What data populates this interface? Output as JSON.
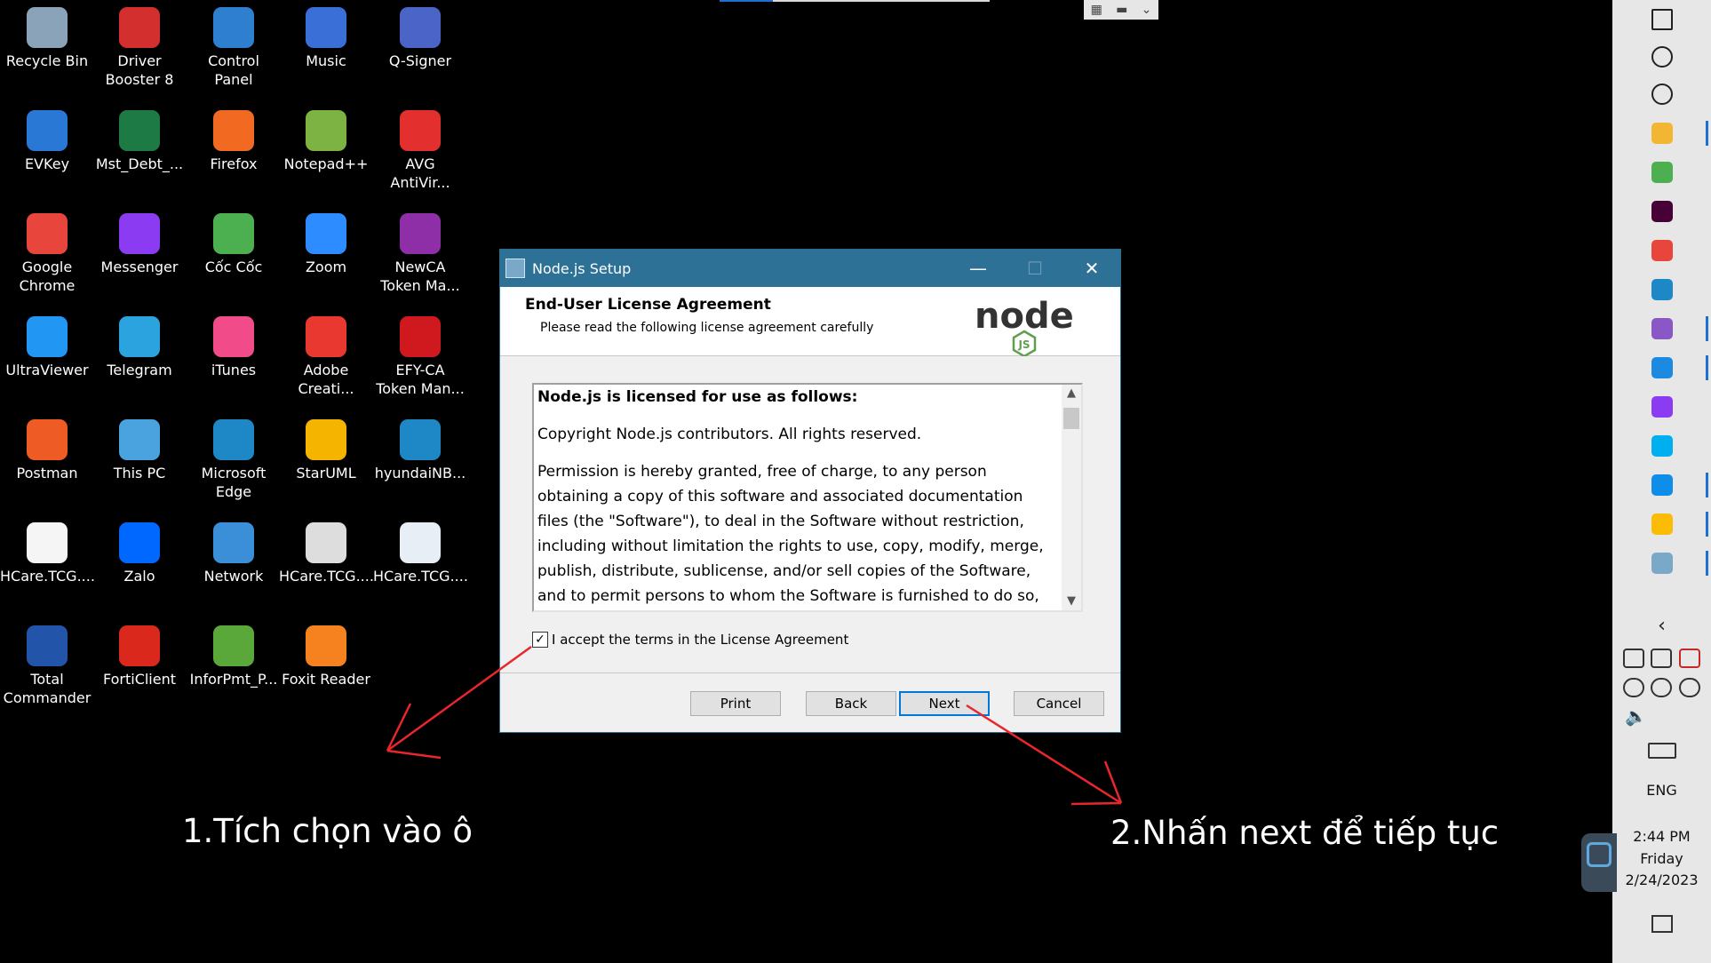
{
  "desktop_icons": [
    {
      "label": "Recycle Bin",
      "icon": "recycle-bin-icon",
      "color": "#8aa3b8"
    },
    {
      "label": "Driver\nBooster 8",
      "icon": "driver-booster-icon",
      "color": "#d32f2f"
    },
    {
      "label": "Control\nPanel",
      "icon": "control-panel-icon",
      "color": "#2f7fd1"
    },
    {
      "label": "Music",
      "icon": "music-folder-icon",
      "color": "#3b6fd8"
    },
    {
      "label": "Q-Signer",
      "icon": "q-signer-icon",
      "color": "#4a64c8"
    },
    {
      "label": "EVKey",
      "icon": "evkey-icon",
      "color": "#2a78d6"
    },
    {
      "label": "Mst_Debt_...",
      "icon": "excel-icon",
      "color": "#1d7a44"
    },
    {
      "label": "Firefox",
      "icon": "firefox-icon",
      "color": "#f26a21"
    },
    {
      "label": "Notepad++",
      "icon": "notepad-plus-plus-icon",
      "color": "#7cb342"
    },
    {
      "label": "AVG\nAntiVir...",
      "icon": "avg-antivirus-icon",
      "color": "#e3302f"
    },
    {
      "label": "Google\nChrome",
      "icon": "chrome-icon",
      "color": "#e8453c"
    },
    {
      "label": "Messenger",
      "icon": "messenger-icon",
      "color": "#8b3cf3"
    },
    {
      "label": "Cốc Cốc",
      "icon": "coccoc-icon",
      "color": "#4caf50"
    },
    {
      "label": "Zoom",
      "icon": "zoom-icon",
      "color": "#2d8cff"
    },
    {
      "label": "NewCA\nToken Ma...",
      "icon": "newca-token-icon",
      "color": "#8e2fa8"
    },
    {
      "label": "UltraViewer",
      "icon": "ultraviewer-icon",
      "color": "#2196f3"
    },
    {
      "label": "Telegram",
      "icon": "telegram-icon",
      "color": "#2aa3df"
    },
    {
      "label": "iTunes",
      "icon": "itunes-icon",
      "color": "#f14b8a"
    },
    {
      "label": "Adobe\nCreati...",
      "icon": "adobe-creative-cloud-icon",
      "color": "#e8382f"
    },
    {
      "label": "EFY-CA\nToken Man...",
      "icon": "efy-ca-token-icon",
      "color": "#d0191f"
    },
    {
      "label": "Postman",
      "icon": "postman-icon",
      "color": "#ef5b25"
    },
    {
      "label": "This PC",
      "icon": "this-pc-icon",
      "color": "#4aa3df"
    },
    {
      "label": "Microsoft\nEdge",
      "icon": "edge-icon",
      "color": "#1e88c7"
    },
    {
      "label": "StarUML",
      "icon": "staruml-icon",
      "color": "#f4b400"
    },
    {
      "label": "hyundaiNB...",
      "icon": "edge-shortcut-icon",
      "color": "#1e88c7"
    },
    {
      "label": "HCare.TCG....",
      "icon": "file-icon",
      "color": "#f5f5f5"
    },
    {
      "label": "Zalo",
      "icon": "zalo-icon",
      "color": "#0068ff"
    },
    {
      "label": "Network",
      "icon": "network-icon",
      "color": "#3a8fd8"
    },
    {
      "label": "HCare.TCG....",
      "icon": "config-file-icon",
      "color": "#dddddd"
    },
    {
      "label": "HCare.TCG....",
      "icon": "document-icon",
      "color": "#e8eef5"
    },
    {
      "label": "Total\nCommander",
      "icon": "total-commander-icon",
      "color": "#2255aa"
    },
    {
      "label": "FortiClient",
      "icon": "forticlient-icon",
      "color": "#da291c"
    },
    {
      "label": "InforPmt_P...",
      "icon": "chart-file-icon",
      "color": "#5aa83a"
    },
    {
      "label": "Foxit Reader",
      "icon": "foxit-reader-icon",
      "color": "#f5821f"
    }
  ],
  "dialog": {
    "title": "Node.js Setup",
    "header_title": "End-User License Agreement",
    "header_subtitle": "Please read the following license agreement carefully",
    "logo_text": "node",
    "logo_badge": "JS",
    "license_heading": "Node.js is licensed for use as follows:",
    "license_paragraphs": [
      "Copyright Node.js contributors. All rights reserved.",
      "Permission is hereby granted, free of charge, to any person obtaining a copy of this software and associated documentation files (the \"Software\"), to deal in the Software without restriction, including without limitation the rights to use, copy, modify, merge, publish, distribute, sublicense, and/or sell copies of the Software, and to permit persons to whom the Software is furnished to do so, subject"
    ],
    "accept_label": "I accept the terms in the License Agreement",
    "accept_checked": true,
    "buttons": {
      "print": "Print",
      "back": "Back",
      "next": "Next",
      "cancel": "Cancel"
    },
    "controls": {
      "minimize": "—",
      "maximize": "☐",
      "close": "✕"
    },
    "accent_color": "#2e7197"
  },
  "annotations": {
    "caption_1": "1.Tích chọn vào ô",
    "caption_2": "2.Nhấn next để tiếp tục",
    "arrow_color": "#e8262b"
  },
  "taskbar": {
    "pinned": [
      {
        "icon": "start-icon"
      },
      {
        "icon": "search-icon"
      },
      {
        "icon": "cortana-icon"
      },
      {
        "icon": "file-explorer-icon",
        "color": "#f2b632",
        "running": true
      },
      {
        "icon": "coccoc-icon",
        "color": "#4caf50"
      },
      {
        "icon": "adobe-xd-icon",
        "color": "#470137"
      },
      {
        "icon": "chrome-icon",
        "color": "#e8453c"
      },
      {
        "icon": "edge-icon",
        "color": "#1e88c7"
      },
      {
        "icon": "visual-studio-icon",
        "color": "#8a58c6",
        "running": true
      },
      {
        "icon": "vscode-icon",
        "color": "#1b8ae0",
        "running": true
      },
      {
        "icon": "messenger-icon",
        "color": "#8b3cf3"
      },
      {
        "icon": "skype-icon",
        "color": "#00aff0"
      },
      {
        "icon": "teamviewer-icon",
        "color": "#0e8ee9",
        "running": true
      },
      {
        "icon": "chrome-icon",
        "color": "#fbbc05",
        "running": true
      },
      {
        "icon": "nodejs-setup-icon",
        "color": "#7aa8c9",
        "running": true
      }
    ],
    "language": "ENG",
    "time": "2:44 PM",
    "day": "Friday",
    "date": "2/24/2023"
  }
}
